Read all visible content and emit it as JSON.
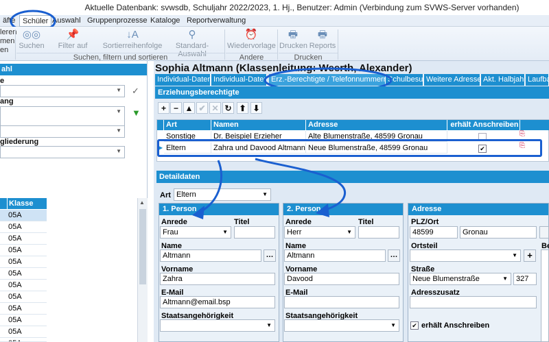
{
  "window": {
    "title": "Aktuelle Datenbank: svwsdb, Schuljahr 2022/2023, 1. Hj., Benutzer: Admin (Verbindung zum SVWS-Server vorhanden)"
  },
  "menu": {
    "items": [
      "äfte",
      "Schüler",
      "Auswahl",
      "Gruppenprozesse",
      "Kataloge",
      "Reportverwaltung"
    ]
  },
  "ribbon": {
    "left_fragments": [
      "leren",
      "men",
      "en"
    ],
    "buttons": [
      {
        "label": "Suchen",
        "icon": "binoculars-icon"
      },
      {
        "label": "Filter auf",
        "icon": "pin-icon"
      },
      {
        "label": "Sortierreihenfolge",
        "icon": "sort-icon"
      },
      {
        "label": "Standard-Auswahl",
        "icon": "reset-filter-icon"
      },
      {
        "label": "Wiedervorlage",
        "icon": "alarm-clock-icon"
      },
      {
        "label": "Drucken",
        "icon": "printer-icon"
      },
      {
        "label": "Reports",
        "icon": "printer-icon"
      }
    ],
    "groups": [
      "Suchen, filtern und sortieren",
      "Andere",
      "Drucken"
    ]
  },
  "left": {
    "header": "ahl",
    "labels": [
      "e",
      "ang",
      "gliederung"
    ],
    "grid_header": "Klasse",
    "rows": [
      "05A",
      "05A",
      "05A",
      "05A",
      "05A",
      "05A",
      "05A",
      "05A",
      "05A",
      "05A",
      "05A",
      "05A"
    ]
  },
  "student": {
    "heading": "Sophia Altmann (Klassenleitung: Weerth, Alexander)"
  },
  "tabs": [
    "Individual-Daten I",
    "Individual-Daten II",
    "Erz.-Berechtigte / Telefonnummern",
    "Schulbesuch",
    "Weitere Adressen",
    "Akt. Halbjahr",
    "Laufbahn"
  ],
  "erz": {
    "header": "Erziehungsberechtigte",
    "toolbar": [
      "+",
      "−",
      "▲",
      "✔",
      "✕",
      "↻",
      "⬆",
      "⬇"
    ],
    "columns": [
      "Art",
      "Namen",
      "Adresse",
      "erhält Anschreiben"
    ],
    "rows": [
      {
        "art": "Sonstige",
        "namen": "Dr. Beispiel Erzieher",
        "adresse": "Alte Blumenstraße, 48599 Gronau",
        "anschreiben": false
      },
      {
        "art": "Eltern",
        "namen": "Zahra und Davood Altmann",
        "adresse": "Neue Blumenstraße, 48599 Gronau",
        "anschreiben": true
      }
    ]
  },
  "detail": {
    "header": "Detaildaten",
    "art_label": "Art",
    "art_value": "Eltern",
    "person1": {
      "header": "1. Person",
      "anrede_label": "Anrede",
      "anrede": "Frau",
      "titel_label": "Titel",
      "titel": "",
      "name_label": "Name",
      "name": "Altmann",
      "vorname_label": "Vorname",
      "vorname": "Zahra",
      "email_label": "E-Mail",
      "email": "Altmann@email.bsp",
      "staat_label": "Staatsangehörigkeit",
      "staat": ""
    },
    "person2": {
      "header": "2. Person",
      "anrede_label": "Anrede",
      "anrede": "Herr",
      "titel_label": "Titel",
      "titel": "",
      "name_label": "Name",
      "name": "Altmann",
      "vorname_label": "Vorname",
      "vorname": "Davood",
      "email_label": "E-Mail",
      "email": "",
      "staat_label": "Staatsangehörigkeit",
      "staat": ""
    },
    "adresse": {
      "header": "Adresse",
      "plz_label": "PLZ/Ort",
      "plz": "48599",
      "ort": "Gronau",
      "ortsteil_label": "Ortsteil",
      "ortsteil": "",
      "strasse_label": "Straße",
      "strasse": "Neue Blumenstraße",
      "hausnr": "327",
      "zusatz_label": "Adresszusatz",
      "zusatz": "",
      "anschreiben_label": "erhält Anschreiben",
      "anschreiben": true
    },
    "extra_label": "Be"
  },
  "colors": {
    "header_blue": "#1d8fd0",
    "highlight_blue": "#1a5fd0"
  }
}
